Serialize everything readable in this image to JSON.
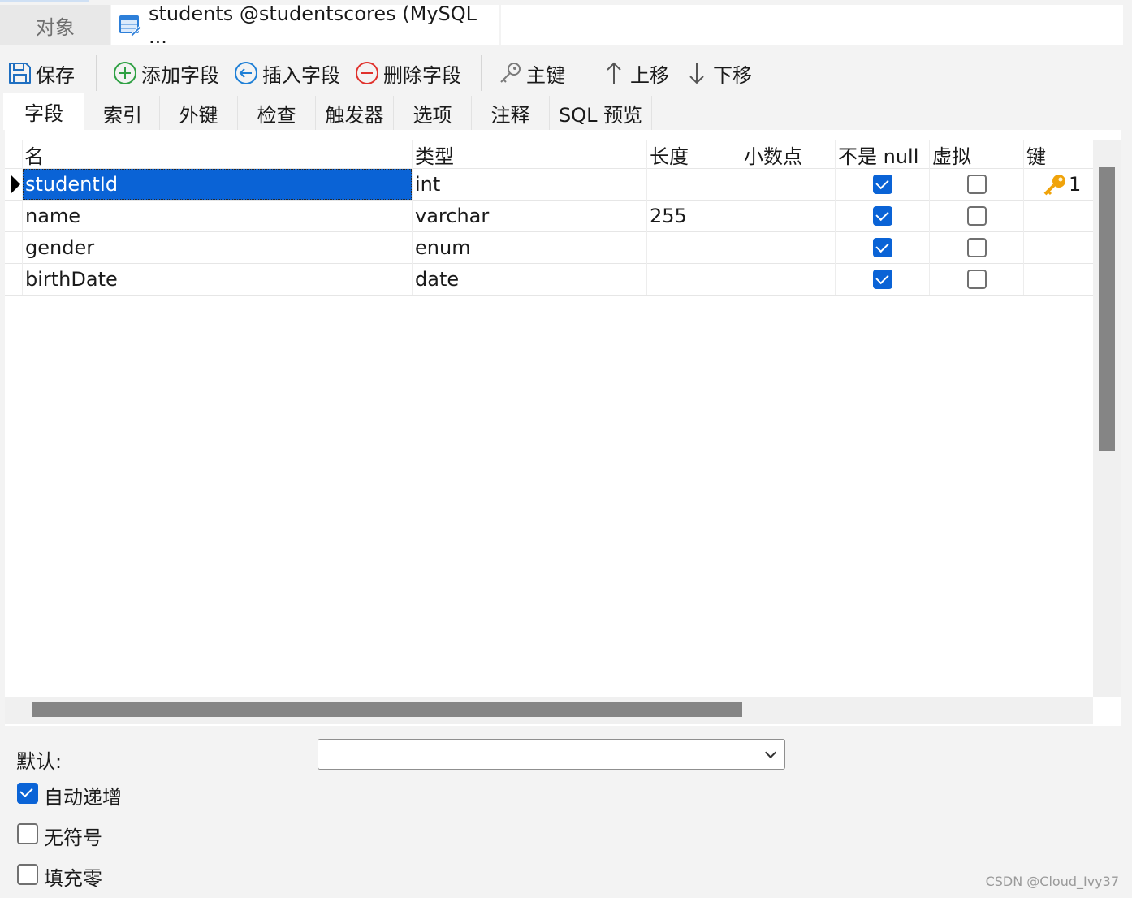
{
  "window_tabs": {
    "objects_tab": "对象",
    "active_tab": "students @studentscores (MySQL ..."
  },
  "toolbar": {
    "save": "保存",
    "add_field": "添加字段",
    "insert_field": "插入字段",
    "delete_field": "删除字段",
    "primary_key": "主键",
    "move_up": "上移",
    "move_down": "下移"
  },
  "subtabs": [
    "字段",
    "索引",
    "外键",
    "检查",
    "触发器",
    "选项",
    "注释",
    "SQL 预览"
  ],
  "grid": {
    "headers": [
      "名",
      "类型",
      "长度",
      "小数点",
      "不是 null",
      "虚拟",
      "键"
    ],
    "rows": [
      {
        "name": "studentId",
        "type": "int",
        "length": "",
        "decimals": "",
        "not_null": true,
        "virtual": false,
        "key": "1"
      },
      {
        "name": "name",
        "type": "varchar",
        "length": "255",
        "decimals": "",
        "not_null": true,
        "virtual": false,
        "key": ""
      },
      {
        "name": "gender",
        "type": "enum",
        "length": "",
        "decimals": "",
        "not_null": true,
        "virtual": false,
        "key": ""
      },
      {
        "name": "birthDate",
        "type": "date",
        "length": "",
        "decimals": "",
        "not_null": true,
        "virtual": false,
        "key": ""
      }
    ],
    "selected_row": 0,
    "vertical_scroll_fraction": 0.51,
    "horizontal_scroll_fraction": 0.65
  },
  "properties": {
    "default_label": "默认:",
    "default_value": "",
    "auto_increment_label": "自动递增",
    "auto_increment": true,
    "unsigned_label": "无符号",
    "unsigned": false,
    "zerofill_label": "填充零",
    "zerofill": false
  },
  "watermark": "CSDN @Cloud_Ivy37",
  "colors": {
    "accent": "#0a63d6",
    "key_icon": "#f0a30a",
    "add_icon": "#2ea043",
    "insert_icon": "#1e7fd6",
    "delete_icon": "#e0312c"
  }
}
